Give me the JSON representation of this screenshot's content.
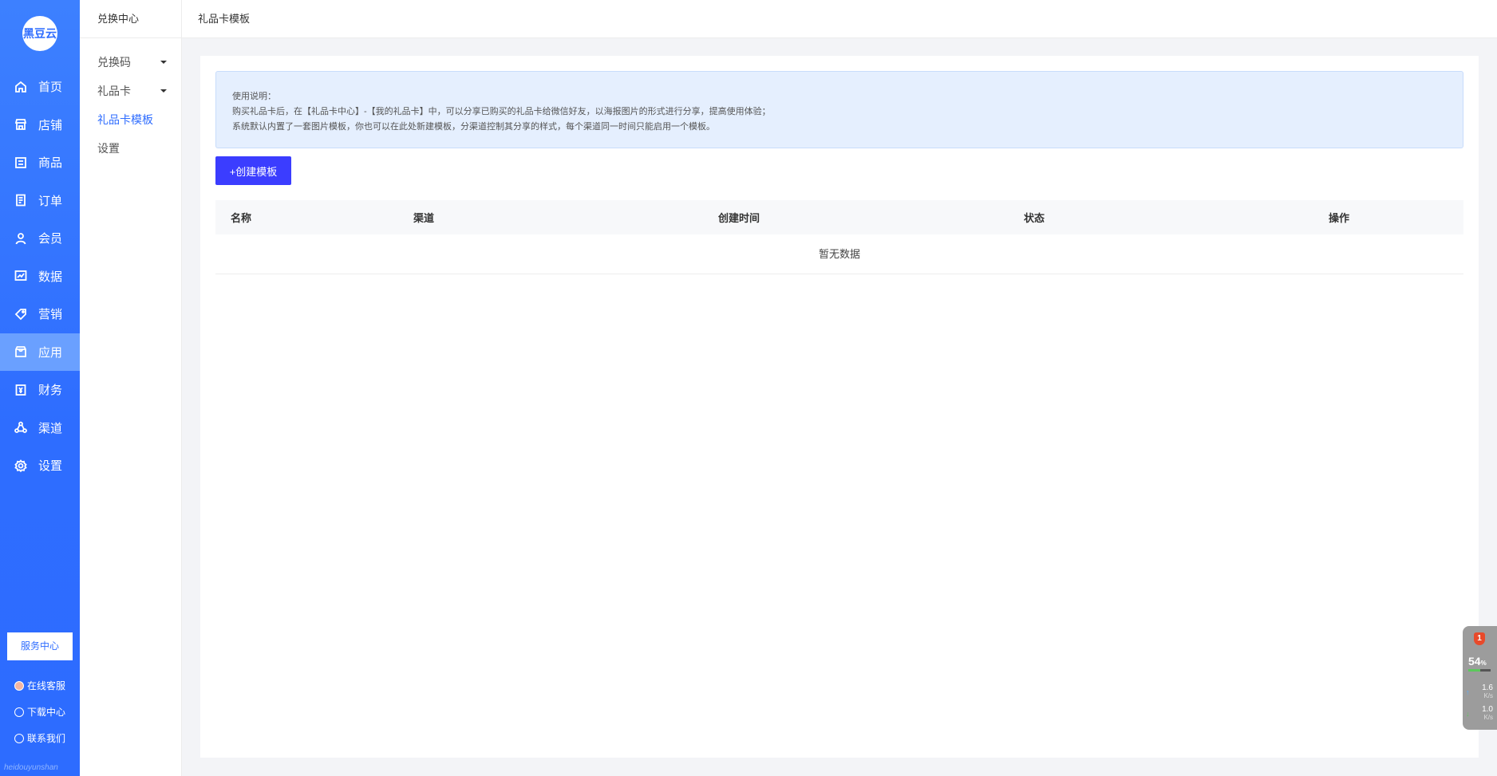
{
  "sidebar": {
    "logo": "黑豆云",
    "items": [
      {
        "label": "首页",
        "icon": "home-icon"
      },
      {
        "label": "店铺",
        "icon": "store-icon"
      },
      {
        "label": "商品",
        "icon": "goods-icon"
      },
      {
        "label": "订单",
        "icon": "order-icon"
      },
      {
        "label": "会员",
        "icon": "member-icon"
      },
      {
        "label": "数据",
        "icon": "chart-icon"
      },
      {
        "label": "营销",
        "icon": "tag-icon"
      },
      {
        "label": "应用",
        "icon": "app-icon"
      },
      {
        "label": "财务",
        "icon": "finance-icon"
      },
      {
        "label": "渠道",
        "icon": "channel-icon"
      },
      {
        "label": "设置",
        "icon": "gear-icon"
      }
    ],
    "active_index": 7,
    "service_center": "服务中心",
    "links": [
      {
        "label": "在线客服",
        "icon": "avatar-icon"
      },
      {
        "label": "下载中心",
        "icon": "download-icon"
      },
      {
        "label": "联系我们",
        "icon": "chat-icon"
      }
    ],
    "watermark": "heidouyunshan"
  },
  "subsidebar": {
    "title": "兑换中心",
    "items": [
      {
        "label": "兑换码",
        "has_caret": true
      },
      {
        "label": "礼品卡",
        "has_caret": true
      },
      {
        "label": "礼品卡模板",
        "active": true
      },
      {
        "label": "设置"
      }
    ]
  },
  "topbar": {
    "breadcrumb": "礼品卡模板"
  },
  "notice": {
    "lines": [
      "使用说明：",
      "购买礼品卡后，在【礼品卡中心】-【我的礼品卡】中，可以分享已购买的礼品卡给微信好友，以海报图片的形式进行分享，提高使用体验；",
      "系统默认内置了一套图片模板，你也可以在此处新建模板，分渠道控制其分享的样式，每个渠道同一时间只能启用一个模板。"
    ]
  },
  "create_button": "+创建模板",
  "table": {
    "columns": [
      "名称",
      "渠道",
      "创建时间",
      "状态",
      "操作"
    ],
    "empty_text": "暂无数据"
  },
  "widget": {
    "alert_count": "1",
    "cpu_percent": "54",
    "percent_sign": "%",
    "upload": "1.6",
    "download": "1.0",
    "unit": "K/s"
  },
  "colors": {
    "sidebar": "#2f6dff",
    "active_nav": "#6aa0ff",
    "primary_button": "#3b3dff",
    "notice_bg": "#e5effe"
  }
}
